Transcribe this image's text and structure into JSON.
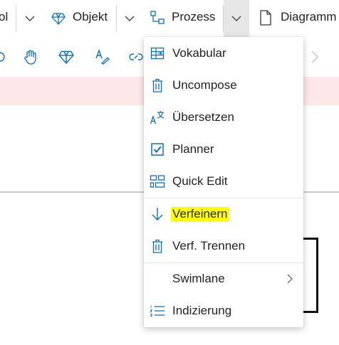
{
  "topbar": {
    "left_fragment": "ol",
    "objekt_label": "Objekt",
    "prozess_label": "Prozess",
    "diagramm_label": "Diagramm"
  },
  "menu": {
    "items": [
      {
        "label": "Vokabular",
        "icon": "vocabulary-icon"
      },
      {
        "label": "Uncompose",
        "icon": "trash-icon"
      },
      {
        "label": "Übersetzen",
        "icon": "translate-icon"
      },
      {
        "label": "Planner",
        "icon": "checkbox-icon"
      },
      {
        "label": "Quick Edit",
        "icon": "quick-edit-icon"
      },
      {
        "label": "Verfeinern",
        "icon": "arrow-down-icon",
        "highlighted": true
      },
      {
        "label": "Verf. Trennen",
        "icon": "trash-icon"
      },
      {
        "label": "Swimlane",
        "icon": "chevron-right-icon",
        "has_submenu": true
      },
      {
        "label": "Indizierung",
        "icon": "numbered-list-icon"
      }
    ]
  },
  "colors": {
    "accent_blue": "#0f6cbd",
    "highlight": "#ffff00",
    "banner_pink": "#fde7e9",
    "active_button_bg": "#e6e6e6"
  }
}
